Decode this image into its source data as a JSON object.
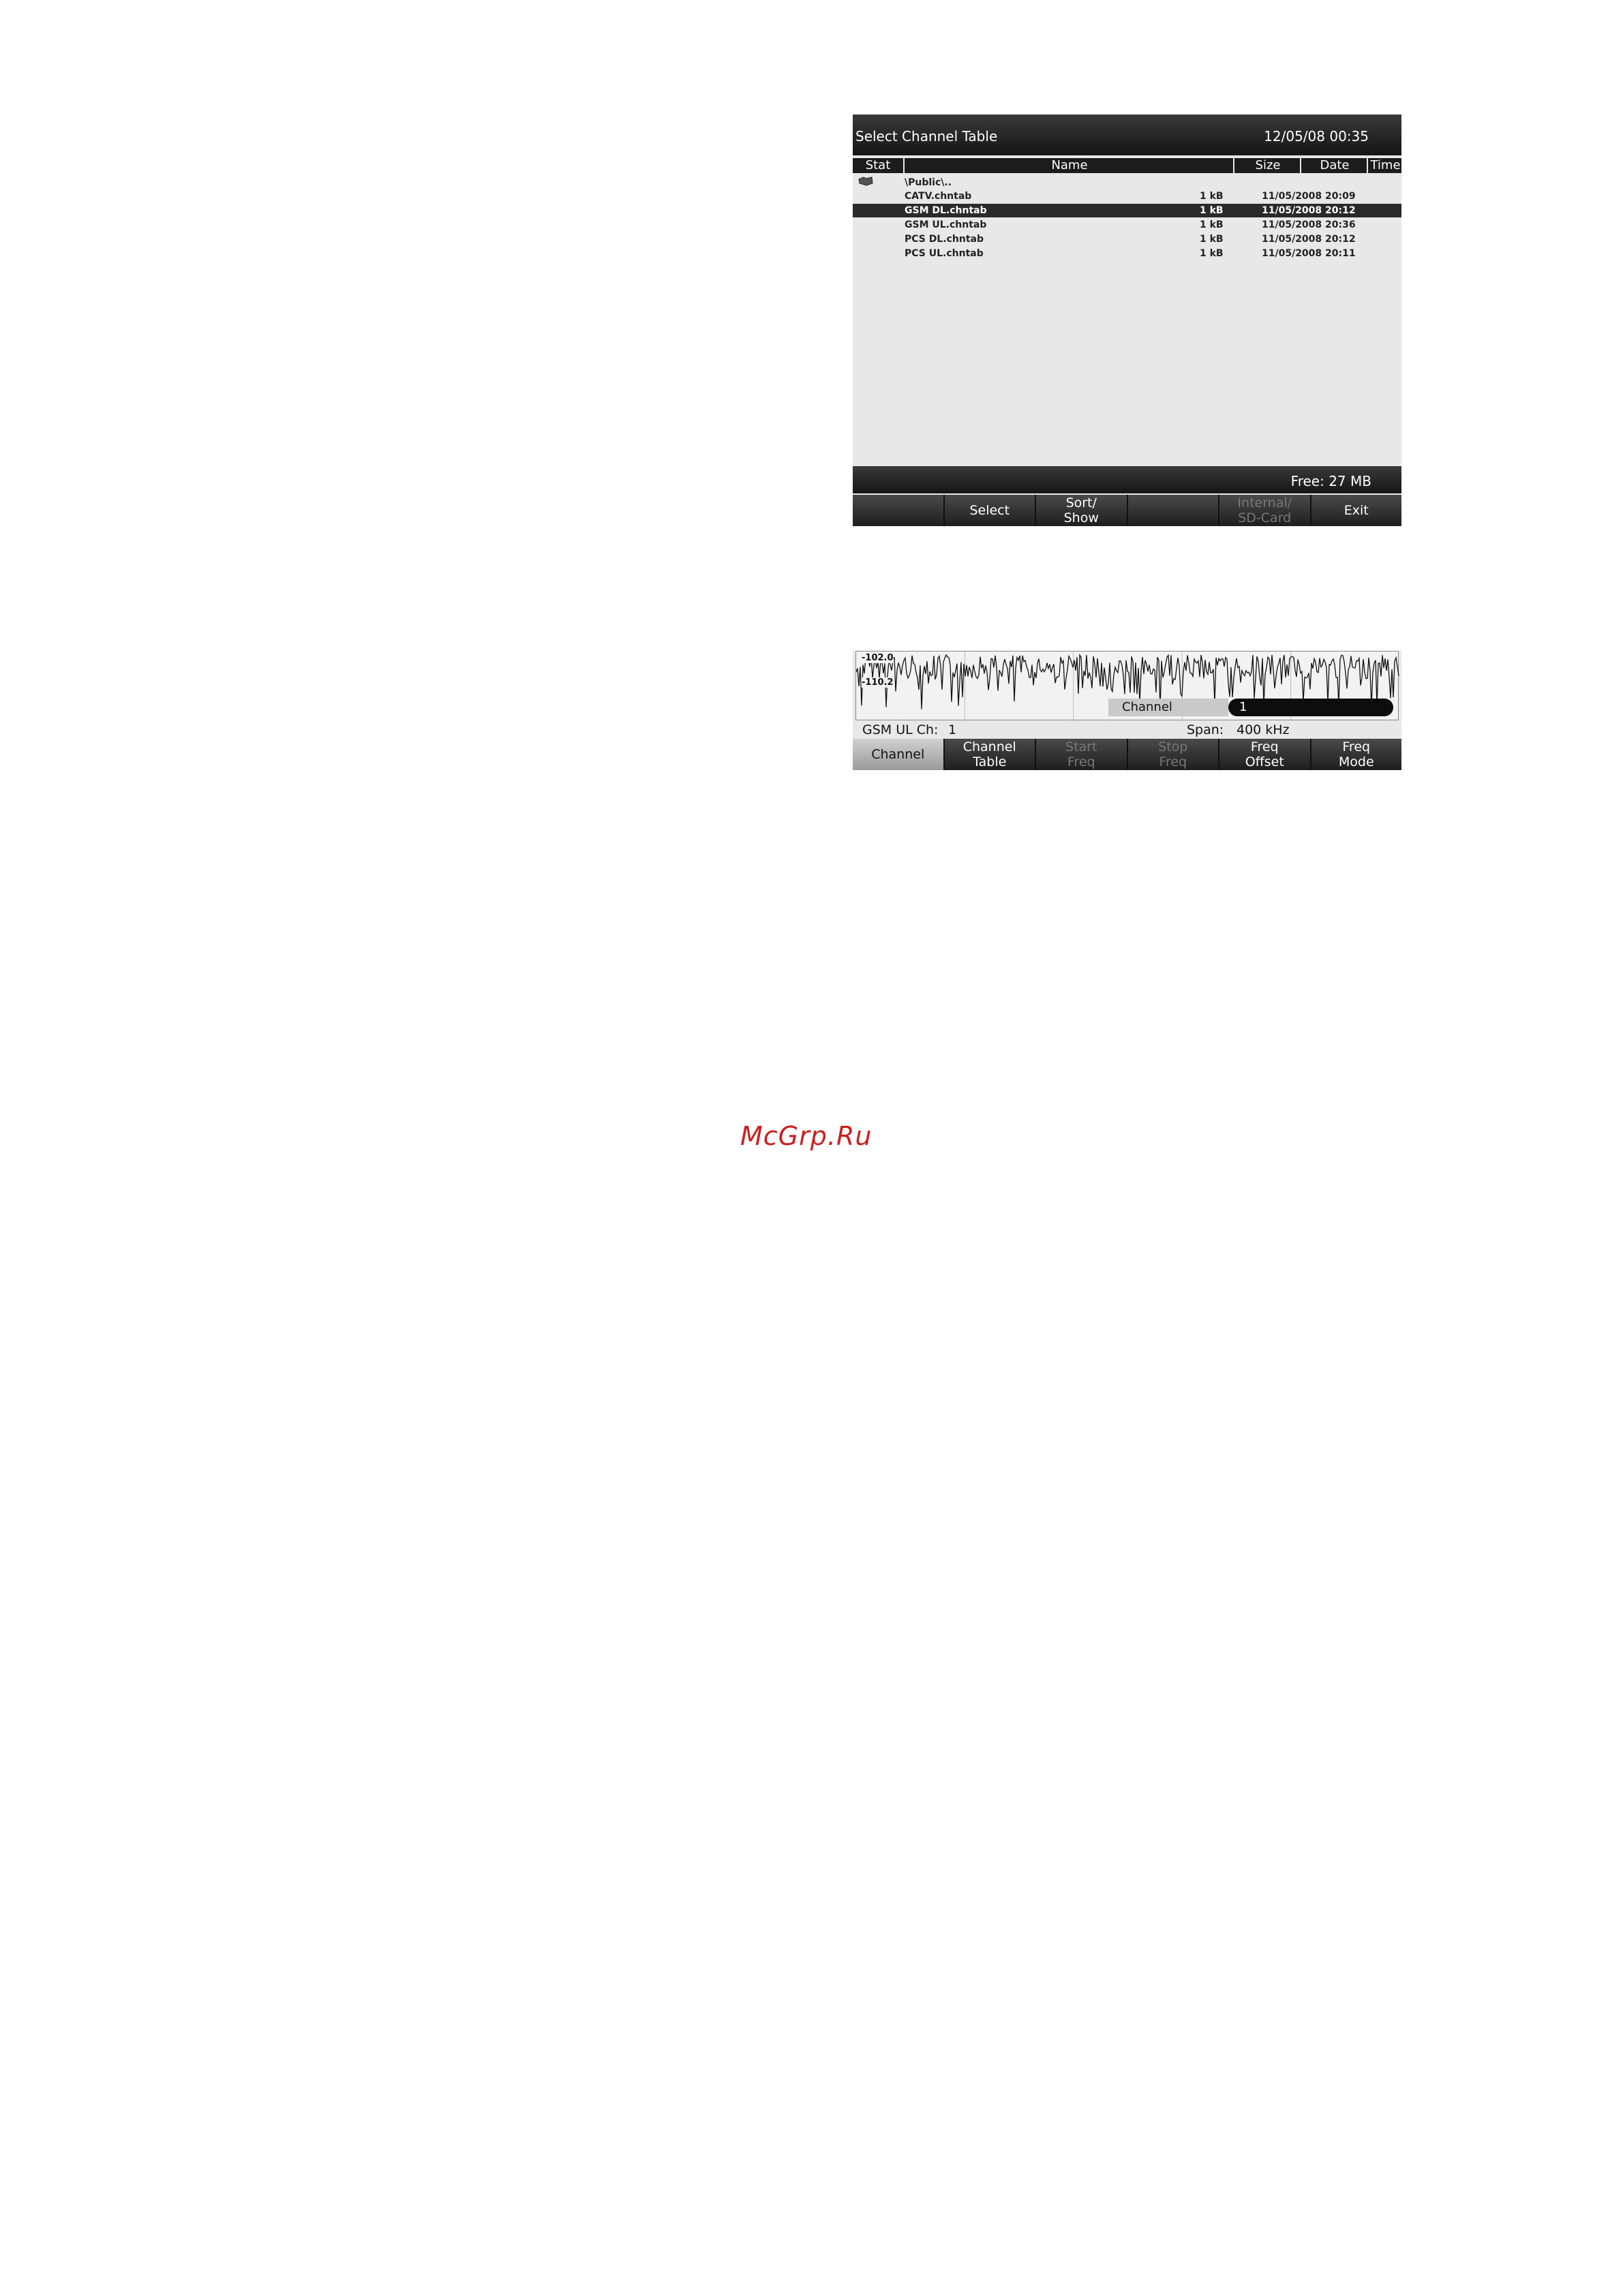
{
  "file_dialog": {
    "title": "Select Channel Table",
    "datetime": "12/05/08 00:35",
    "columns": {
      "stat": "Stat",
      "name": "Name",
      "size": "Size",
      "date": "Date",
      "time": "Time"
    },
    "path_row": {
      "icon": "folder-icon",
      "name": "\\Public\\.."
    },
    "files": [
      {
        "name": "CATV.chntab",
        "size": "1 kB",
        "datetime": "11/05/2008 20:09",
        "selected": false
      },
      {
        "name": "GSM DL.chntab",
        "size": "1 kB",
        "datetime": "11/05/2008 20:12",
        "selected": true
      },
      {
        "name": "GSM UL.chntab",
        "size": "1 kB",
        "datetime": "11/05/2008 20:36",
        "selected": false
      },
      {
        "name": "PCS DL.chntab",
        "size": "1 kB",
        "datetime": "11/05/2008 20:12",
        "selected": false
      },
      {
        "name": "PCS UL.chntab",
        "size": "1 kB",
        "datetime": "11/05/2008 20:11",
        "selected": false
      }
    ],
    "free_space": "Free: 27 MB",
    "softkeys": [
      {
        "label": "",
        "disabled": false
      },
      {
        "label": "Select",
        "disabled": false
      },
      {
        "label": "Sort/\nShow",
        "disabled": false
      },
      {
        "label": "",
        "disabled": false
      },
      {
        "label": "Internal/\nSD-Card",
        "disabled": true
      },
      {
        "label": "Exit",
        "disabled": false
      }
    ]
  },
  "channel_entry": {
    "ref_level_top": "-102.0",
    "ref_level_bottom": "-110.2",
    "entry_label": "Channel",
    "entry_value": "1",
    "channel_label": "GSM UL Ch:",
    "channel_value": "1",
    "span_label": "Span:",
    "span_value": "400 kHz",
    "softkeys": [
      {
        "label": "Channel",
        "disabled": false,
        "active": true
      },
      {
        "label": "Channel\nTable",
        "disabled": false,
        "active": false
      },
      {
        "label": "Start\nFreq",
        "disabled": true,
        "active": false
      },
      {
        "label": "Stop\nFreq",
        "disabled": true,
        "active": false
      },
      {
        "label": "Freq\nOffset",
        "disabled": false,
        "active": false
      },
      {
        "label": "Freq\nMode",
        "disabled": false,
        "active": false
      }
    ]
  },
  "watermark": "McGrp.Ru"
}
